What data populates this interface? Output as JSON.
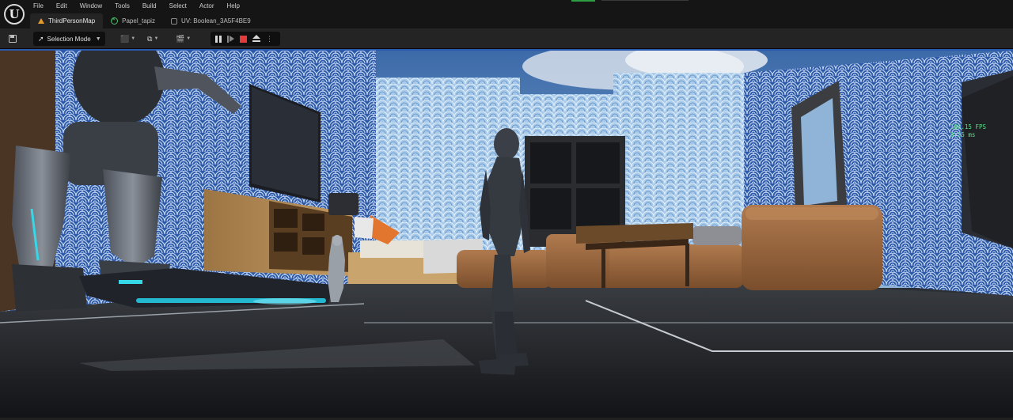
{
  "app": {
    "logo": "unreal-engine-logo"
  },
  "menu": [
    "File",
    "Edit",
    "Window",
    "Tools",
    "Build",
    "Select",
    "Actor",
    "Help"
  ],
  "tabs": [
    {
      "label": "ThirdPersonMap",
      "icon": "level-icon",
      "active": true
    },
    {
      "label": "Papel_tapiz",
      "icon": "material-icon",
      "active": false
    },
    {
      "label": "UV: Boolean_3A5F4BE9",
      "icon": "uv-icon",
      "active": false
    }
  ],
  "toolbar": {
    "save_icon": "save-icon",
    "mode_label": "Selection Mode",
    "play_controls": [
      "pause",
      "advance-frame",
      "stop",
      "eject"
    ]
  },
  "viewport": {
    "fps": "108.15 FPS",
    "ms": "9.25 ms"
  },
  "colors": {
    "accent_blue": "#2a5ab0",
    "stop_red": "#e23b3b",
    "stats_green": "#5ee08a",
    "wallpaper_blue": "#2f5bb5"
  }
}
